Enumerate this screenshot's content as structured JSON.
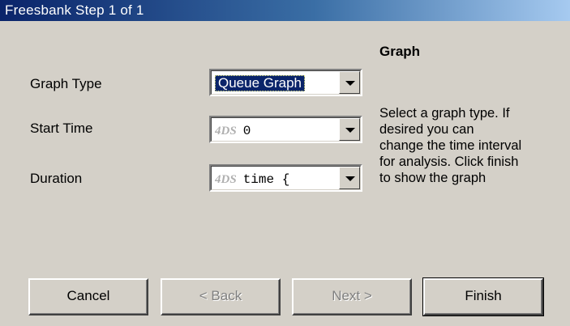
{
  "window": {
    "title": "Freesbank  Step 1 of 1"
  },
  "form": {
    "graph_type": {
      "label": "Graph Type",
      "value": "Queue Graph"
    },
    "start_time": {
      "label": "Start Time",
      "prefix": "4DS",
      "value": "0"
    },
    "duration": {
      "label": "Duration",
      "prefix": "4DS",
      "value": "time {"
    }
  },
  "help": {
    "title": "Graph",
    "lines": [
      "Select a graph type. If",
      "desired you can",
      "change the time interval",
      "for analysis. Click finish",
      "to show the graph"
    ]
  },
  "buttons": {
    "cancel": "Cancel",
    "back": "< Back",
    "next": "Next >",
    "finish": "Finish"
  }
}
